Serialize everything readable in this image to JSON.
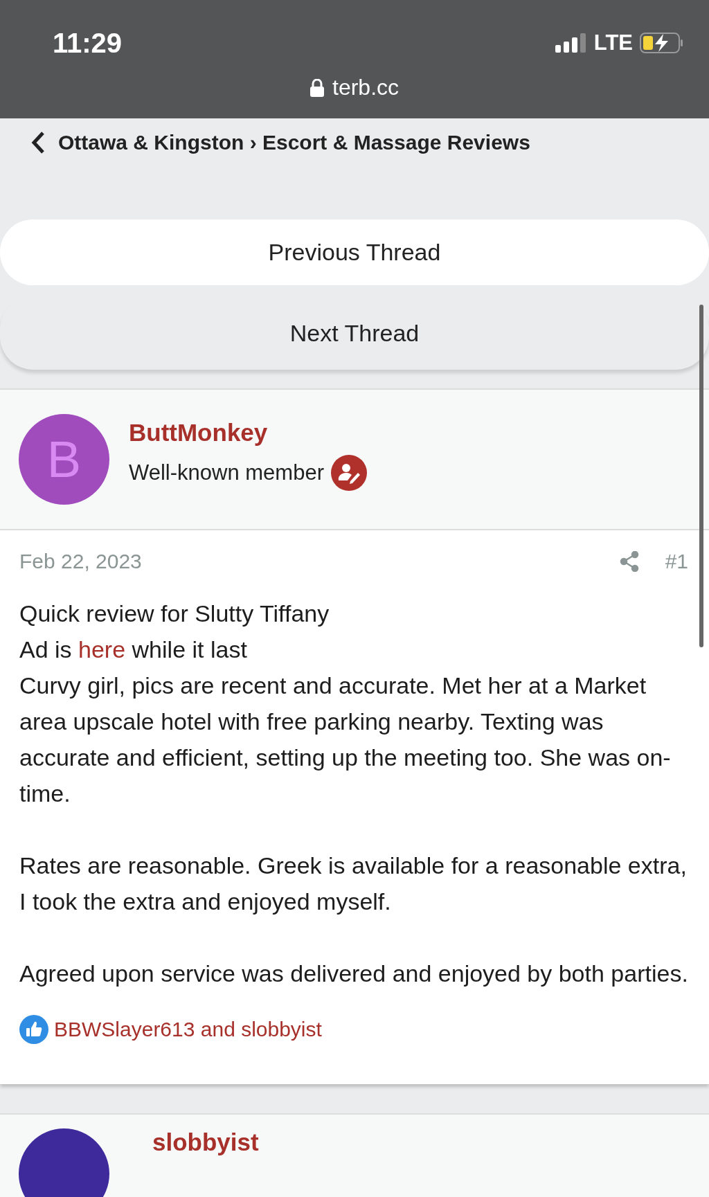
{
  "status_bar": {
    "time": "11:29",
    "network": "LTE",
    "url": "terb.cc"
  },
  "breadcrumb": {
    "path": "Ottawa & Kingston › Escort & Massage Reviews"
  },
  "thread_nav": [
    {
      "label": "Previous Thread",
      "kind": "plain"
    },
    {
      "label": "Next Thread",
      "kind": "raised"
    }
  ],
  "posts": [
    {
      "author": {
        "name": "ButtMonkey",
        "initial": "B",
        "color": "#a04cbc",
        "title": "Well-known member"
      },
      "date": "Feb 22, 2023",
      "number": "#1",
      "body": [
        {
          "kind": "text",
          "text": "Quick review for Slutty Tiffany"
        },
        {
          "kind": "link",
          "before": "Ad is ",
          "link": "here",
          "after": " while it last"
        },
        {
          "kind": "text",
          "text": "Curvy girl, pics are recent and accurate. Met her at a Market area upscale hotel with free parking nearby. Texting was accurate and efficient, setting up the meeting too. She was on-time."
        },
        {
          "kind": "gap"
        },
        {
          "kind": "text",
          "text": "Rates are reasonable. Greek is available for a reasonable extra, I took the extra and enjoyed myself."
        },
        {
          "kind": "gap"
        },
        {
          "kind": "text",
          "text": "Agreed upon service was delivered and enjoyed by both parties."
        }
      ],
      "reactions": "BBWSlayer613 and slobbyist"
    },
    {
      "author": {
        "name": "slobbyist",
        "color": "#3f2a9c"
      }
    }
  ]
}
